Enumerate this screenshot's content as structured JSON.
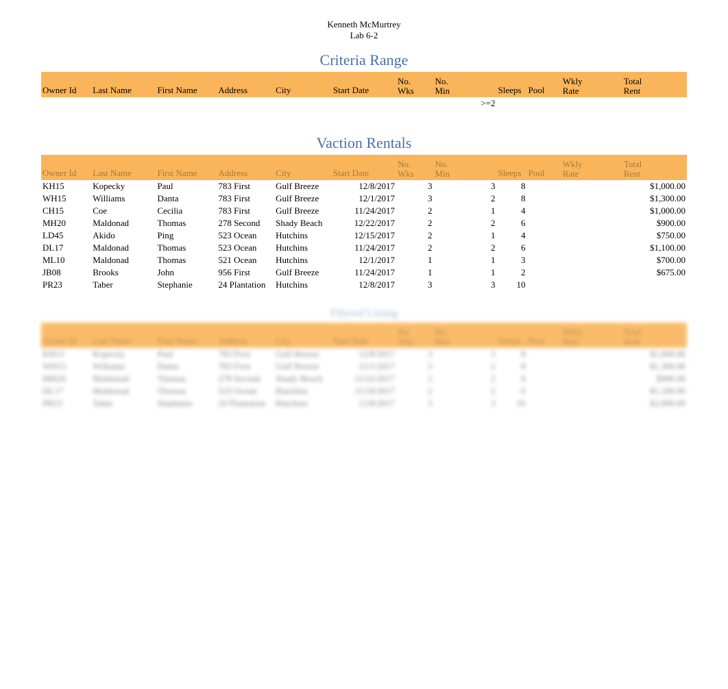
{
  "doc_header": {
    "name": "Kenneth McMurtrey",
    "lab": "Lab 6-2"
  },
  "criteria": {
    "title": "Criteria Range",
    "columns": [
      {
        "key": "owner",
        "label": "Owner Id"
      },
      {
        "key": "last",
        "label": "Last Name"
      },
      {
        "key": "first",
        "label": "First Name"
      },
      {
        "key": "addr",
        "label": "Address"
      },
      {
        "key": "city",
        "label": "City"
      },
      {
        "key": "sdate",
        "label": "Start Date"
      },
      {
        "key": "wks",
        "label1": "No.",
        "label2": "Wks"
      },
      {
        "key": "min",
        "label1": "No.",
        "label2": "Min"
      },
      {
        "key": "sleeps",
        "label": "Sleeps"
      },
      {
        "key": "pool",
        "label": "Pool"
      },
      {
        "key": "rate",
        "label1": "Wkly",
        "label2": "Rate"
      },
      {
        "key": "total",
        "label1": "Total",
        "label2": "Rent"
      }
    ],
    "criteria_row": {
      "min": ">=2"
    }
  },
  "vaction": {
    "title": "Vaction Rentals",
    "columns": [
      {
        "key": "owner",
        "label": "Owner Id"
      },
      {
        "key": "last",
        "label": "Last Name"
      },
      {
        "key": "first",
        "label": "First Name"
      },
      {
        "key": "addr",
        "label": "Address"
      },
      {
        "key": "city",
        "label": "City"
      },
      {
        "key": "sdate",
        "label": "Start Date"
      },
      {
        "key": "wks",
        "label1": "No.",
        "label2": "Wks"
      },
      {
        "key": "min",
        "label1": "No.",
        "label2": "Min"
      },
      {
        "key": "sleeps",
        "label": "Sleeps"
      },
      {
        "key": "pool",
        "label": "Pool"
      },
      {
        "key": "rate",
        "label1": "Wkly",
        "label2": "Rate"
      },
      {
        "key": "total",
        "label1": "Total",
        "label2": "Rent"
      }
    ],
    "rows": [
      {
        "owner": "KH15",
        "last": "Kopecky",
        "first": "Paul",
        "addr": "783 First",
        "city": "Gulf Breeze",
        "sdate": "12/8/2017",
        "wks": "3",
        "min": "3",
        "sleeps": "8",
        "pool": "",
        "rate": "",
        "total": "$1,000.00"
      },
      {
        "owner": "WH15",
        "last": "Williams",
        "first": "Danta",
        "addr": "783 First",
        "city": "Gulf Breeze",
        "sdate": "12/1/2017",
        "wks": "3",
        "min": "2",
        "sleeps": "8",
        "pool": "",
        "rate": "",
        "total": "$1,300.00"
      },
      {
        "owner": "CH15",
        "last": "Coe",
        "first": "Cecilia",
        "addr": "783 First",
        "city": "Gulf Breeze",
        "sdate": "11/24/2017",
        "wks": "2",
        "min": "1",
        "sleeps": "4",
        "pool": "",
        "rate": "",
        "total": "$1,000.00"
      },
      {
        "owner": "MH20",
        "last": "Maldonad",
        "first": "Thomas",
        "addr": "278 Second",
        "city": "Shady Beach",
        "sdate": "12/22/2017",
        "wks": "2",
        "min": "2",
        "sleeps": "6",
        "pool": "",
        "rate": "",
        "total": "$900.00"
      },
      {
        "owner": "LD45",
        "last": "Akido",
        "first": "Ping",
        "addr": "523 Ocean",
        "city": "Hutchins",
        "sdate": "12/15/2017",
        "wks": "2",
        "min": "1",
        "sleeps": "4",
        "pool": "",
        "rate": "",
        "total": "$750.00"
      },
      {
        "owner": "DL17",
        "last": "Maldonad",
        "first": "Thomas",
        "addr": "523 Ocean",
        "city": "Hutchins",
        "sdate": "11/24/2017",
        "wks": "2",
        "min": "2",
        "sleeps": "6",
        "pool": "",
        "rate": "",
        "total": "$1,100.00"
      },
      {
        "owner": "ML10",
        "last": "Maldonad",
        "first": "Thomas",
        "addr": "521 Ocean",
        "city": "Hutchins",
        "sdate": "12/1/2017",
        "wks": "1",
        "min": "1",
        "sleeps": "3",
        "pool": "",
        "rate": "",
        "total": "$700.00"
      },
      {
        "owner": "JB08",
        "last": "Brooks",
        "first": "John",
        "addr": "956 First",
        "city": "Gulf Breeze",
        "sdate": "11/24/2017",
        "wks": "1",
        "min": "1",
        "sleeps": "2",
        "pool": "",
        "rate": "",
        "total": "$675.00"
      },
      {
        "owner": "PR23",
        "last": "Taber",
        "first": "Stephanie",
        "addr": "24 Plantation",
        "city": "Hutchins",
        "sdate": "12/8/2017",
        "wks": "3",
        "min": "3",
        "sleeps": "10",
        "pool": "",
        "rate": "",
        "total": "",
        "total_faint": ""
      }
    ]
  },
  "filtered": {
    "title": "Filtered Listing",
    "columns": [
      {
        "key": "owner",
        "label": "Owner Id"
      },
      {
        "key": "last",
        "label": "Last Name"
      },
      {
        "key": "first",
        "label": "First Name"
      },
      {
        "key": "addr",
        "label": "Address"
      },
      {
        "key": "city",
        "label": "City"
      },
      {
        "key": "sdate",
        "label": "Start Date"
      },
      {
        "key": "wks",
        "label1": "No.",
        "label2": "Wks"
      },
      {
        "key": "min",
        "label1": "No.",
        "label2": "Min"
      },
      {
        "key": "sleeps",
        "label": "Sleeps"
      },
      {
        "key": "pool",
        "label": "Pool"
      },
      {
        "key": "rate",
        "label1": "Wkly",
        "label2": "Rate"
      },
      {
        "key": "total",
        "label1": "Total",
        "label2": "Rent"
      }
    ],
    "rows": [
      {
        "owner": "KH15",
        "last": "Kopecky",
        "first": "Paul",
        "addr": "783 First",
        "city": "Gulf Breeze",
        "sdate": "12/8/2017",
        "wks": "3",
        "min": "3",
        "sleeps": "8",
        "pool": "",
        "rate": "",
        "total": "$1,000.00"
      },
      {
        "owner": "WH15",
        "last": "Williams",
        "first": "Danta",
        "addr": "783 First",
        "city": "Gulf Breeze",
        "sdate": "12/1/2017",
        "wks": "3",
        "min": "2",
        "sleeps": "8",
        "pool": "",
        "rate": "",
        "total": "$1,300.00"
      },
      {
        "owner": "MH20",
        "last": "Maldonad",
        "first": "Thomas",
        "addr": "278 Second",
        "city": "Shady Beach",
        "sdate": "12/22/2017",
        "wks": "2",
        "min": "2",
        "sleeps": "6",
        "pool": "",
        "rate": "",
        "total": "$900.00"
      },
      {
        "owner": "DL17",
        "last": "Maldonad",
        "first": "Thomas",
        "addr": "523 Ocean",
        "city": "Hutchins",
        "sdate": "11/24/2017",
        "wks": "2",
        "min": "2",
        "sleeps": "6",
        "pool": "",
        "rate": "",
        "total": "$1,100.00"
      },
      {
        "owner": "PR23",
        "last": "Taber",
        "first": "Stephanie",
        "addr": "24 Plantation",
        "city": "Hutchins",
        "sdate": "12/8/2017",
        "wks": "3",
        "min": "3",
        "sleeps": "10",
        "pool": "",
        "rate": "",
        "total": "$2,000.00"
      }
    ]
  }
}
